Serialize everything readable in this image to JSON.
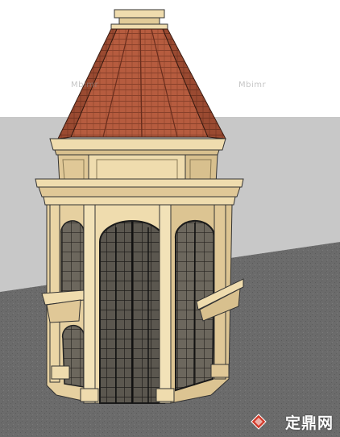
{
  "watermarks": [
    "Mbimr",
    "Mbimr"
  ],
  "logo": {
    "text": "定鼎网",
    "icon": "diamond-logo-icon"
  },
  "colors": {
    "sky": "#ffffff",
    "horizon_plane": "#c9c9c9",
    "ground": "#6e6e6e",
    "stucco": "#efdcae",
    "stucco_shadow": "#d8c08e",
    "roof_tile": "#b45a3d",
    "roof_dark": "#7e3a26",
    "glass": "#5f5a52",
    "frame": "#2c2a28"
  }
}
